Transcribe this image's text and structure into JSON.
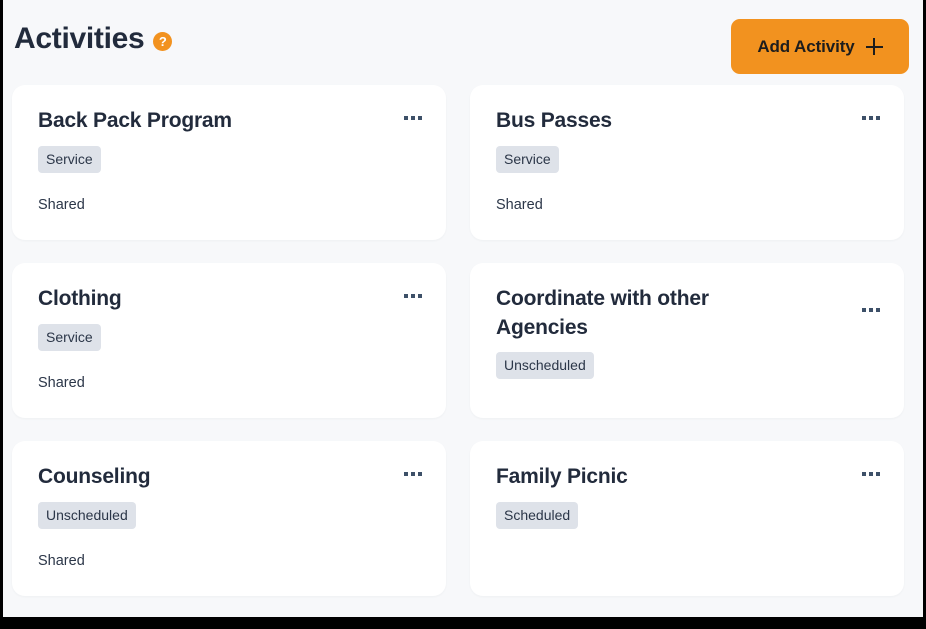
{
  "header": {
    "title": "Activities",
    "help_icon_label": "?",
    "help_icon_name": "help-circle-icon",
    "add_button_label": "Add Activity",
    "add_button_icon": "plus-icon"
  },
  "theme": {
    "accent_orange": "#f2921f",
    "page_background": "#f7f8fa",
    "card_background": "#ffffff",
    "text_dark": "#222b3c",
    "badge_background": "#dee2e9",
    "menu_dot_color": "#3d5068"
  },
  "activities": [
    {
      "title": "Back Pack Program",
      "badge": "Service",
      "sharing": "Shared",
      "menu_icon": "ellipsis-icon"
    },
    {
      "title": "Bus Passes",
      "badge": "Service",
      "sharing": "Shared",
      "menu_icon": "ellipsis-icon"
    },
    {
      "title": "Clothing",
      "badge": "Service",
      "sharing": "Shared",
      "menu_icon": "ellipsis-icon"
    },
    {
      "title": "Coordinate with other Agencies",
      "badge": "Unscheduled",
      "sharing": "",
      "menu_icon": "ellipsis-icon"
    },
    {
      "title": "Counseling",
      "badge": "Unscheduled",
      "sharing": "Shared",
      "menu_icon": "ellipsis-icon"
    },
    {
      "title": "Family Picnic",
      "badge": "Scheduled",
      "sharing": "",
      "menu_icon": "ellipsis-icon"
    }
  ]
}
